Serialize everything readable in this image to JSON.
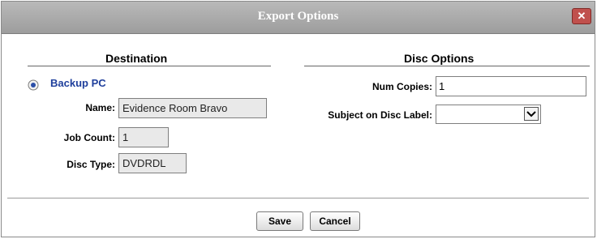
{
  "dialog": {
    "title": "Export Options",
    "close_glyph": "✕"
  },
  "destination": {
    "heading": "Destination",
    "option_label": "Backup PC",
    "name_label": "Name:",
    "name_value": "Evidence Room Bravo",
    "job_count_label": "Job Count:",
    "job_count_value": "1",
    "disc_type_label": "Disc Type:",
    "disc_type_value": "DVDRDL"
  },
  "disc_options": {
    "heading": "Disc Options",
    "num_copies_label": "Num Copies:",
    "num_copies_value": "1",
    "subject_label": "Subject on Disc Label:",
    "subject_value": ""
  },
  "buttons": {
    "save": "Save",
    "cancel": "Cancel"
  }
}
